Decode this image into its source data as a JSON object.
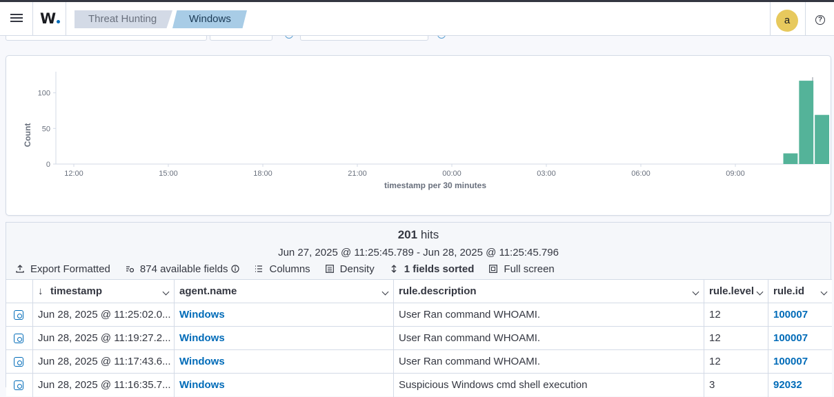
{
  "header": {
    "logo": "W.",
    "breadcrumbs": [
      "Threat Hunting",
      "Windows"
    ],
    "avatar_initial": "a",
    "help_glyph": "?"
  },
  "chart_data": {
    "type": "bar",
    "xlabel": "timestamp per 30 minutes",
    "ylabel": "Count",
    "x_ticks": [
      "12:00",
      "15:00",
      "18:00",
      "21:00",
      "00:00",
      "03:00",
      "06:00",
      "09:00"
    ],
    "y_ticks": [
      "0",
      "50",
      "100"
    ],
    "ylim": [
      0,
      120
    ],
    "bar_color": "#54b399",
    "bars": [
      {
        "x": "10:30",
        "value": 15
      },
      {
        "x": "11:00",
        "value": 117
      },
      {
        "x": "11:30",
        "value": 69
      }
    ]
  },
  "results": {
    "hits_count": "201",
    "hits_label": "hits",
    "time_range": "Jun 27, 2025 @ 11:25:45.789 - Jun 28, 2025 @ 11:25:45.796",
    "toolbar": {
      "export": "Export Formatted",
      "fields": "874 available fields",
      "columns": "Columns",
      "density": "Density",
      "sorted": "1 fields sorted",
      "fullscreen": "Full screen"
    },
    "columns": [
      "timestamp",
      "agent.name",
      "rule.description",
      "rule.level",
      "rule.id"
    ],
    "rows": [
      {
        "timestamp": "Jun 28, 2025 @ 11:25:02.0...",
        "agent": "Windows",
        "description": "User Ran command WHOAMI.",
        "level": "12",
        "id": "100007"
      },
      {
        "timestamp": "Jun 28, 2025 @ 11:19:27.2...",
        "agent": "Windows",
        "description": "User Ran command WHOAMI.",
        "level": "12",
        "id": "100007"
      },
      {
        "timestamp": "Jun 28, 2025 @ 11:17:43.6...",
        "agent": "Windows",
        "description": "User Ran command WHOAMI.",
        "level": "12",
        "id": "100007"
      },
      {
        "timestamp": "Jun 28, 2025 @ 11:16:35.7...",
        "agent": "Windows",
        "description": "Suspicious Windows cmd shell execution",
        "level": "3",
        "id": "92032"
      }
    ]
  }
}
